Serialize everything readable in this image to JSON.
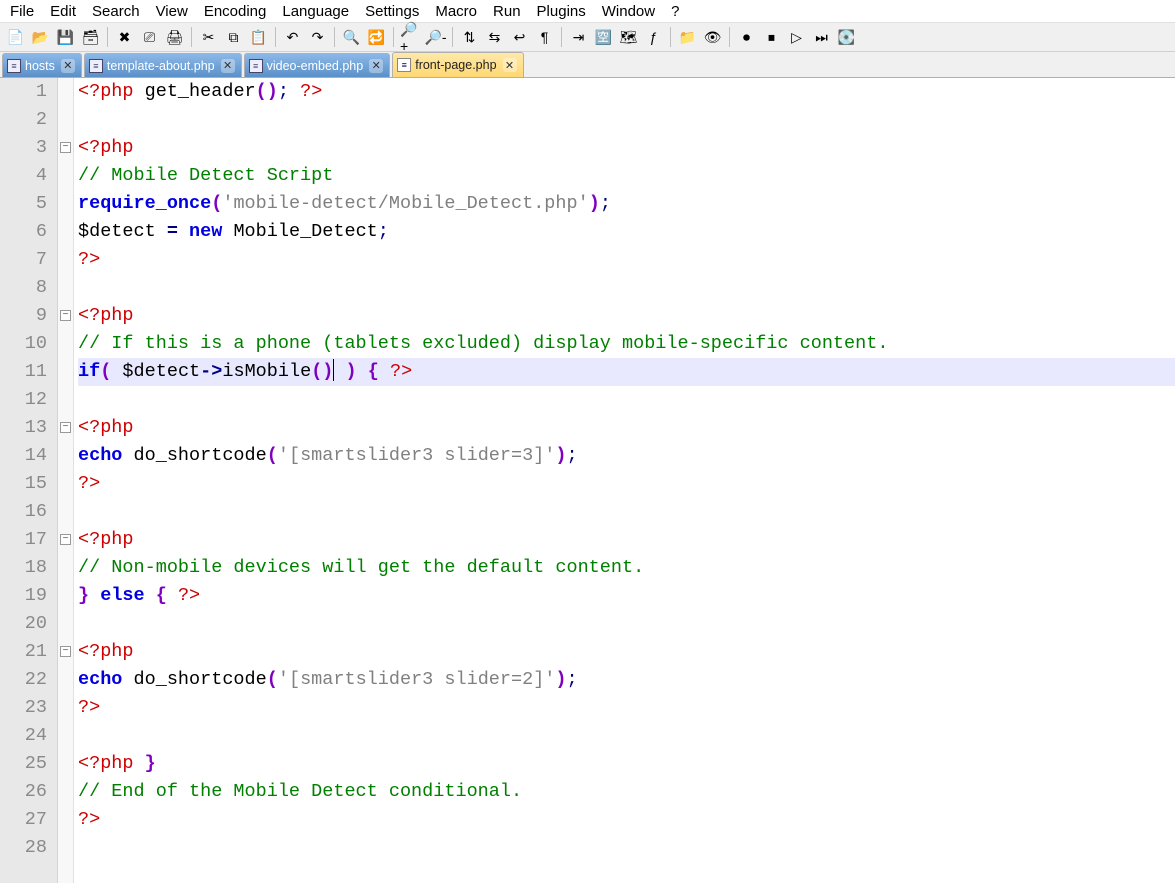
{
  "menu": {
    "items": [
      "File",
      "Edit",
      "Search",
      "View",
      "Encoding",
      "Language",
      "Settings",
      "Macro",
      "Run",
      "Plugins",
      "Window",
      "?"
    ]
  },
  "toolbar": {
    "buttons": [
      {
        "name": "new-file-icon",
        "glyph": "📄"
      },
      {
        "name": "open-icon",
        "glyph": "📂"
      },
      {
        "name": "save-icon",
        "glyph": "💾"
      },
      {
        "name": "save-all-icon",
        "glyph": "🗃"
      },
      {
        "sep": true
      },
      {
        "name": "close-icon",
        "glyph": "✖"
      },
      {
        "name": "close-all-icon",
        "glyph": "⎚"
      },
      {
        "name": "print-icon",
        "glyph": "🖨"
      },
      {
        "sep": true
      },
      {
        "name": "cut-icon",
        "glyph": "✂"
      },
      {
        "name": "copy-icon",
        "glyph": "⧉"
      },
      {
        "name": "paste-icon",
        "glyph": "📋"
      },
      {
        "sep": true
      },
      {
        "name": "undo-icon",
        "glyph": "↶"
      },
      {
        "name": "redo-icon",
        "glyph": "↷"
      },
      {
        "sep": true
      },
      {
        "name": "find-icon",
        "glyph": "🔍"
      },
      {
        "name": "replace-icon",
        "glyph": "🔁"
      },
      {
        "sep": true
      },
      {
        "name": "zoom-in-icon",
        "glyph": "🔎+"
      },
      {
        "name": "zoom-out-icon",
        "glyph": "🔎-"
      },
      {
        "sep": true
      },
      {
        "name": "sync-v-icon",
        "glyph": "⇅"
      },
      {
        "name": "sync-h-icon",
        "glyph": "⇆"
      },
      {
        "name": "wrap-icon",
        "glyph": "↩"
      },
      {
        "name": "all-chars-icon",
        "glyph": "¶"
      },
      {
        "sep": true
      },
      {
        "name": "indent-guide-icon",
        "glyph": "⇥"
      },
      {
        "name": "lang-icon",
        "glyph": "🈳"
      },
      {
        "name": "doc-map-icon",
        "glyph": "🗺"
      },
      {
        "name": "func-list-icon",
        "glyph": "ƒ"
      },
      {
        "sep": true
      },
      {
        "name": "folder-icon",
        "glyph": "📁"
      },
      {
        "name": "monitor-icon",
        "glyph": "👁"
      },
      {
        "sep": true
      },
      {
        "name": "record-icon",
        "glyph": "⏺"
      },
      {
        "name": "stop-icon",
        "glyph": "⏹"
      },
      {
        "name": "play-icon",
        "glyph": "▷"
      },
      {
        "name": "run-multi-icon",
        "glyph": "⏭"
      },
      {
        "name": "save-macro-icon",
        "glyph": "💽"
      }
    ]
  },
  "tabs": [
    {
      "label": "hosts",
      "active": false
    },
    {
      "label": "template-about.php",
      "active": false
    },
    {
      "label": "video-embed.php",
      "active": false
    },
    {
      "label": "front-page.php",
      "active": true
    }
  ],
  "editor": {
    "current_line": 11,
    "fold_markers_at": [
      3,
      9,
      13,
      17,
      21
    ],
    "lines": [
      {
        "n": 1,
        "tokens": [
          [
            "c-tag",
            "<?php "
          ],
          [
            "c-func",
            "get_header"
          ],
          [
            "c-paren",
            "()"
          ],
          [
            "c-punc",
            ";"
          ],
          [
            "c-tag",
            " ?>"
          ]
        ]
      },
      {
        "n": 2,
        "tokens": []
      },
      {
        "n": 3,
        "tokens": [
          [
            "c-tag",
            "<?php"
          ]
        ]
      },
      {
        "n": 4,
        "tokens": [
          [
            "c-cmt",
            "// Mobile Detect Script"
          ]
        ]
      },
      {
        "n": 5,
        "tokens": [
          [
            "c-kw",
            "require_once"
          ],
          [
            "c-paren",
            "("
          ],
          [
            "c-str",
            "'mobile-detect/Mobile_Detect.php'"
          ],
          [
            "c-paren",
            ")"
          ],
          [
            "c-punc",
            ";"
          ]
        ]
      },
      {
        "n": 6,
        "tokens": [
          [
            "c-var",
            "$detect "
          ],
          [
            "c-op",
            "="
          ],
          [
            "c-kw",
            " new "
          ],
          [
            "c-func",
            "Mobile_Detect"
          ],
          [
            "c-punc",
            ";"
          ]
        ]
      },
      {
        "n": 7,
        "tokens": [
          [
            "c-tag",
            "?>"
          ]
        ]
      },
      {
        "n": 8,
        "tokens": []
      },
      {
        "n": 9,
        "tokens": [
          [
            "c-tag",
            "<?php"
          ]
        ]
      },
      {
        "n": 10,
        "tokens": [
          [
            "c-cmt",
            "// If this is a phone (tablets excluded) display mobile-specific content."
          ]
        ]
      },
      {
        "n": 11,
        "hl": true,
        "tokens": [
          [
            "c-kw",
            "if"
          ],
          [
            "c-paren",
            "("
          ],
          [
            "c-var",
            " $detect"
          ],
          [
            "c-op",
            "->"
          ],
          [
            "c-func",
            "isMobile"
          ],
          [
            "c-paren",
            "()"
          ],
          [
            "caret",
            ""
          ],
          [
            "c-var",
            " "
          ],
          [
            "c-paren",
            ")"
          ],
          [
            "c-var",
            " "
          ],
          [
            "c-paren",
            "{"
          ],
          [
            "c-tag",
            " ?>"
          ]
        ]
      },
      {
        "n": 12,
        "tokens": []
      },
      {
        "n": 13,
        "tokens": [
          [
            "c-tag",
            "<?php"
          ]
        ]
      },
      {
        "n": 14,
        "tokens": [
          [
            "c-kw",
            "echo "
          ],
          [
            "c-func",
            "do_shortcode"
          ],
          [
            "c-paren",
            "("
          ],
          [
            "c-str",
            "'[smartslider3 slider=3]'"
          ],
          [
            "c-paren",
            ")"
          ],
          [
            "c-punc",
            ";"
          ]
        ]
      },
      {
        "n": 15,
        "tokens": [
          [
            "c-tag",
            "?>"
          ]
        ]
      },
      {
        "n": 16,
        "tokens": []
      },
      {
        "n": 17,
        "tokens": [
          [
            "c-tag",
            "<?php"
          ]
        ]
      },
      {
        "n": 18,
        "tokens": [
          [
            "c-cmt",
            "// Non-mobile devices will get the default content."
          ]
        ]
      },
      {
        "n": 19,
        "tokens": [
          [
            "c-paren",
            "}"
          ],
          [
            "c-kw",
            " else "
          ],
          [
            "c-paren",
            "{"
          ],
          [
            "c-tag",
            " ?>"
          ]
        ]
      },
      {
        "n": 20,
        "tokens": []
      },
      {
        "n": 21,
        "tokens": [
          [
            "c-tag",
            "<?php"
          ]
        ]
      },
      {
        "n": 22,
        "tokens": [
          [
            "c-kw",
            "echo "
          ],
          [
            "c-func",
            "do_shortcode"
          ],
          [
            "c-paren",
            "("
          ],
          [
            "c-str",
            "'[smartslider3 slider=2]'"
          ],
          [
            "c-paren",
            ")"
          ],
          [
            "c-punc",
            ";"
          ]
        ]
      },
      {
        "n": 23,
        "tokens": [
          [
            "c-tag",
            "?>"
          ]
        ]
      },
      {
        "n": 24,
        "tokens": []
      },
      {
        "n": 25,
        "tokens": [
          [
            "c-tag",
            "<?php "
          ],
          [
            "c-paren",
            "}"
          ]
        ]
      },
      {
        "n": 26,
        "tokens": [
          [
            "c-cmt",
            "// End of the Mobile Detect conditional."
          ]
        ]
      },
      {
        "n": 27,
        "tokens": [
          [
            "c-tag",
            "?>"
          ]
        ]
      },
      {
        "n": 28,
        "tokens": []
      }
    ]
  }
}
